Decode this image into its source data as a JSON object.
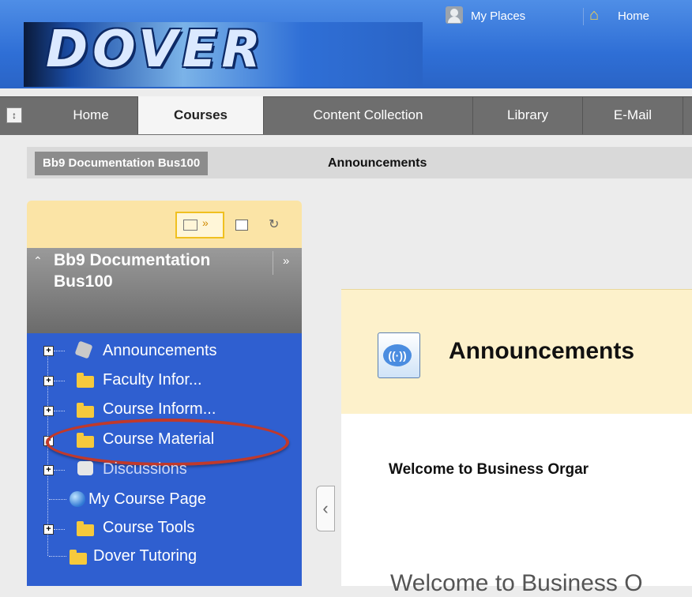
{
  "header": {
    "logo_text": "DOVER",
    "my_places_label": "My Places",
    "home_label": "Home"
  },
  "tabs": [
    {
      "label": "Home",
      "active": false
    },
    {
      "label": "Courses",
      "active": true
    },
    {
      "label": "Content Collection",
      "active": false
    },
    {
      "label": "Library",
      "active": false
    },
    {
      "label": "E-Mail",
      "active": false
    }
  ],
  "breadcrumb": {
    "course": "Bb9 Documentation Bus100",
    "current": "Announcements"
  },
  "course_menu": {
    "title": "Bb9 Documentation Bus100",
    "items": [
      {
        "label": "Announcements",
        "icon": "megaphone-icon",
        "expandable": true
      },
      {
        "label": "Faculty Infor...",
        "icon": "folder-icon",
        "expandable": true
      },
      {
        "label": "Course Inform...",
        "icon": "folder-icon",
        "expandable": true
      },
      {
        "label": "Course Material",
        "icon": "folder-icon",
        "expandable": true,
        "highlighted": true
      },
      {
        "label": "Discussions",
        "icon": "discussion-icon",
        "expandable": true
      },
      {
        "label": "My Course Page",
        "icon": "globe-icon",
        "expandable": false
      },
      {
        "label": "Course Tools",
        "icon": "folder-icon",
        "expandable": true
      },
      {
        "label": "Dover Tutoring",
        "icon": "folder-icon",
        "expandable": false
      }
    ]
  },
  "content": {
    "page_title": "Announcements",
    "welcome_heading": "Welcome to Business Orgar",
    "welcome_text": "Welcome to Business O"
  },
  "colors": {
    "header_blue": "#2f6fd6",
    "menu_blue": "#2f5fd0",
    "content_header": "#fdf1cb",
    "highlight_oval": "#c0392b"
  }
}
